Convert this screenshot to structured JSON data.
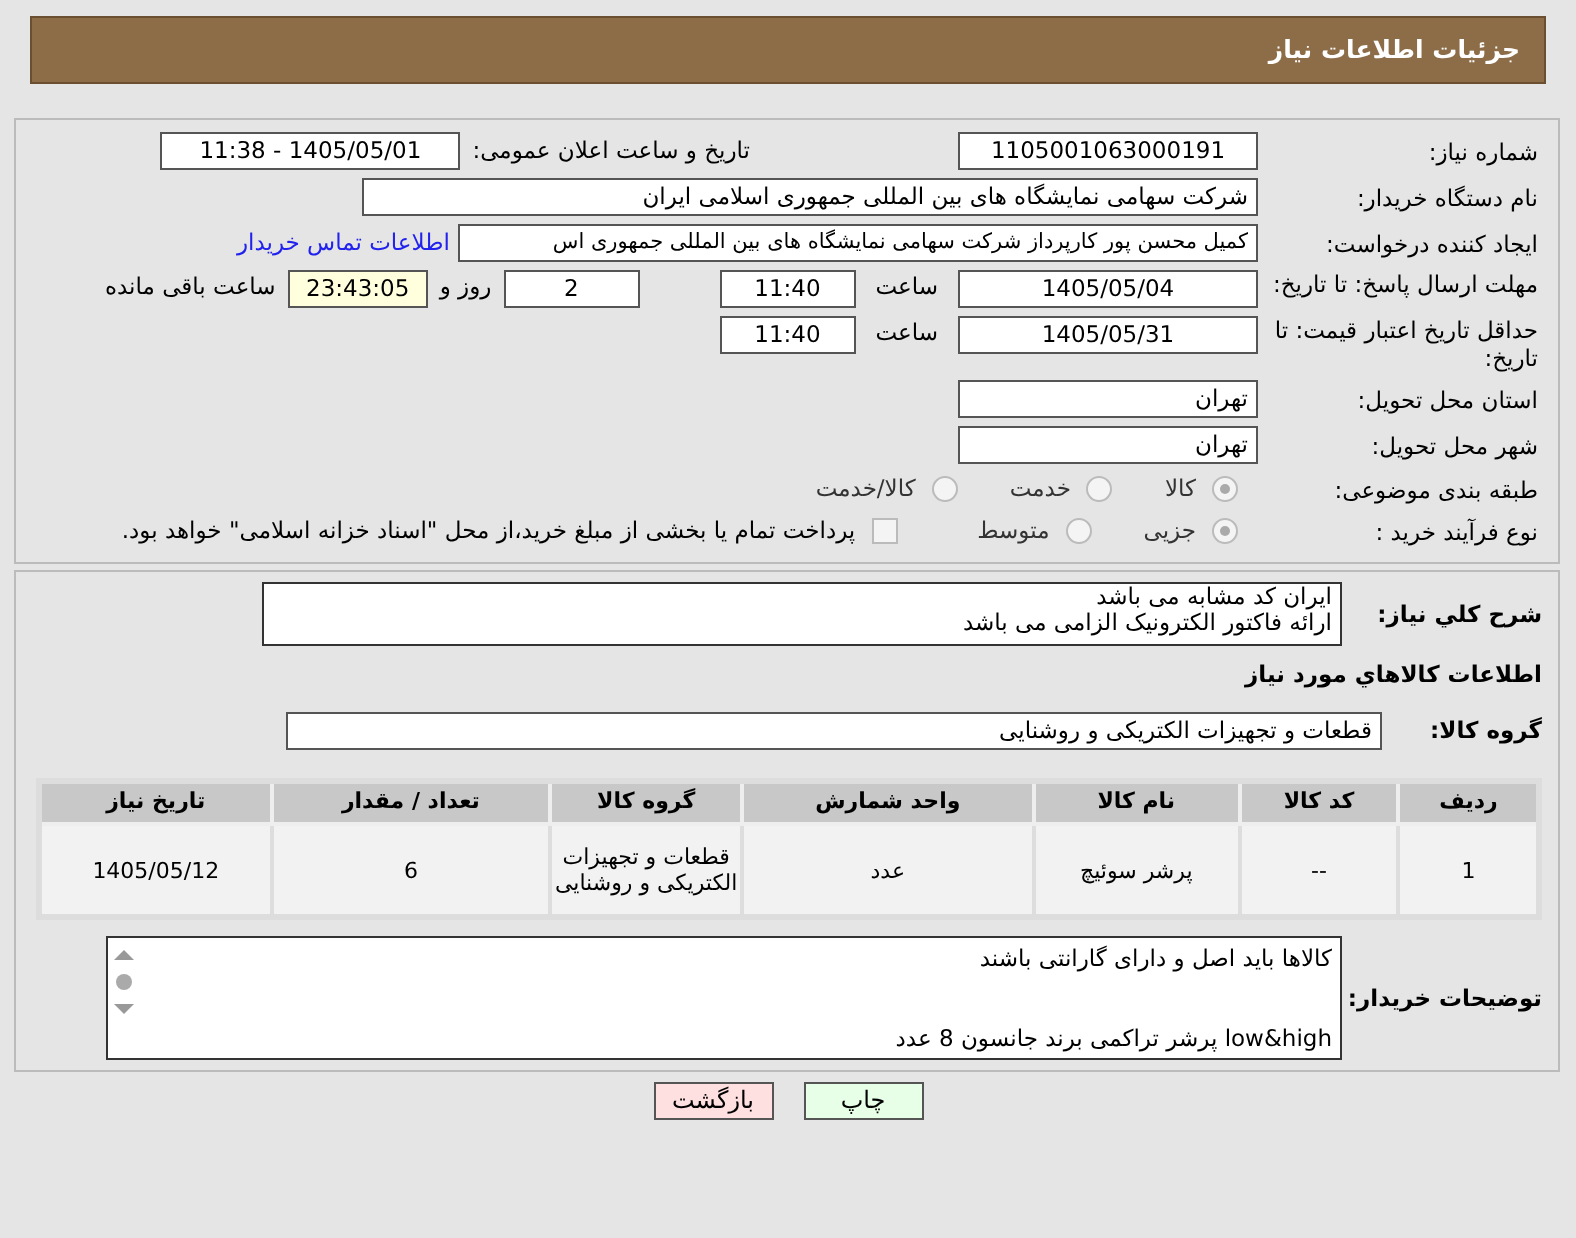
{
  "header": {
    "title": "جزئیات اطلاعات نیاز"
  },
  "need_number": {
    "label": "شماره نیاز:",
    "value": "1105001063000191"
  },
  "announce": {
    "label": "تاریخ و ساعت اعلان عمومی:",
    "value": "1405/05/01 - 11:38"
  },
  "buyer_org": {
    "label": "نام دستگاه خریدار:",
    "value": "شرکت سهامی نمایشگاه های بین المللی جمهوری اسلامی ایران"
  },
  "requester": {
    "label": "ایجاد کننده درخواست:",
    "value": "کمیل محسن پور کارپرداز شرکت سهامی نمایشگاه های بین المللی جمهوری اس",
    "link": "اطلاعات تماس خریدار"
  },
  "deadline": {
    "label": "مهلت ارسال پاسخ: تا تاریخ:",
    "date": "1405/05/04",
    "time_label": "ساعت",
    "time": "11:40",
    "days": "2",
    "days_label": "روز و",
    "remaining": "23:43:05",
    "remaining_label": "ساعت باقی مانده"
  },
  "validity": {
    "label": "حداقل تاریخ اعتبار قیمت: تا تاریخ:",
    "date": "1405/05/31",
    "time_label": "ساعت",
    "time": "11:40"
  },
  "province": {
    "label": "استان محل تحویل:",
    "value": "تهران"
  },
  "city": {
    "label": "شهر محل تحویل:",
    "value": "تهران"
  },
  "category": {
    "label": "طبقه بندی موضوعی:",
    "options": [
      {
        "label": "کالا",
        "selected": true
      },
      {
        "label": "خدمت",
        "selected": false
      },
      {
        "label": "کالا/خدمت",
        "selected": false
      }
    ]
  },
  "process": {
    "label": "نوع فرآیند خرید :",
    "options": [
      {
        "label": "جزیی",
        "selected": true
      },
      {
        "label": "متوسط",
        "selected": false
      }
    ],
    "payment": {
      "label": "پرداخت تمام یا بخشی از مبلغ خرید،از محل \"اسناد خزانه اسلامی\" خواهد بود.",
      "checked": false
    }
  },
  "description": {
    "label": "شرح کلي نياز:",
    "lines": [
      "ایران کد مشابه می باشد",
      "ارائه فاکتور الکترونیک الزامی می باشد"
    ]
  },
  "goods_title": "اطلاعات کالاهاي مورد نياز",
  "goods_group": {
    "label": "گروه کالا:",
    "value": "قطعات و تجهیزات الکتریکی و روشنایی"
  },
  "table": {
    "columns": [
      "ردیف",
      "کد کالا",
      "نام کالا",
      "واحد شمارش",
      "گروه کالا",
      "تعداد / مقدار",
      "تاریخ نیاز"
    ],
    "rows": [
      [
        "1",
        "--",
        "پرشر سوئیچ",
        "عدد",
        "قطعات و تجهیزات الکتریکی و روشنایی",
        "6",
        "1405/05/12"
      ]
    ]
  },
  "buyer_notes": {
    "label": "توضیحات خریدار:",
    "lines": [
      "کالاها باید اصل و دارای گارانتی باشند",
      "low&high پرشر تراکمی برند جانسون 8 عدد"
    ]
  },
  "buttons": [
    {
      "label": "چاپ",
      "kind": "print"
    },
    {
      "label": "بازگشت",
      "kind": "back"
    }
  ]
}
